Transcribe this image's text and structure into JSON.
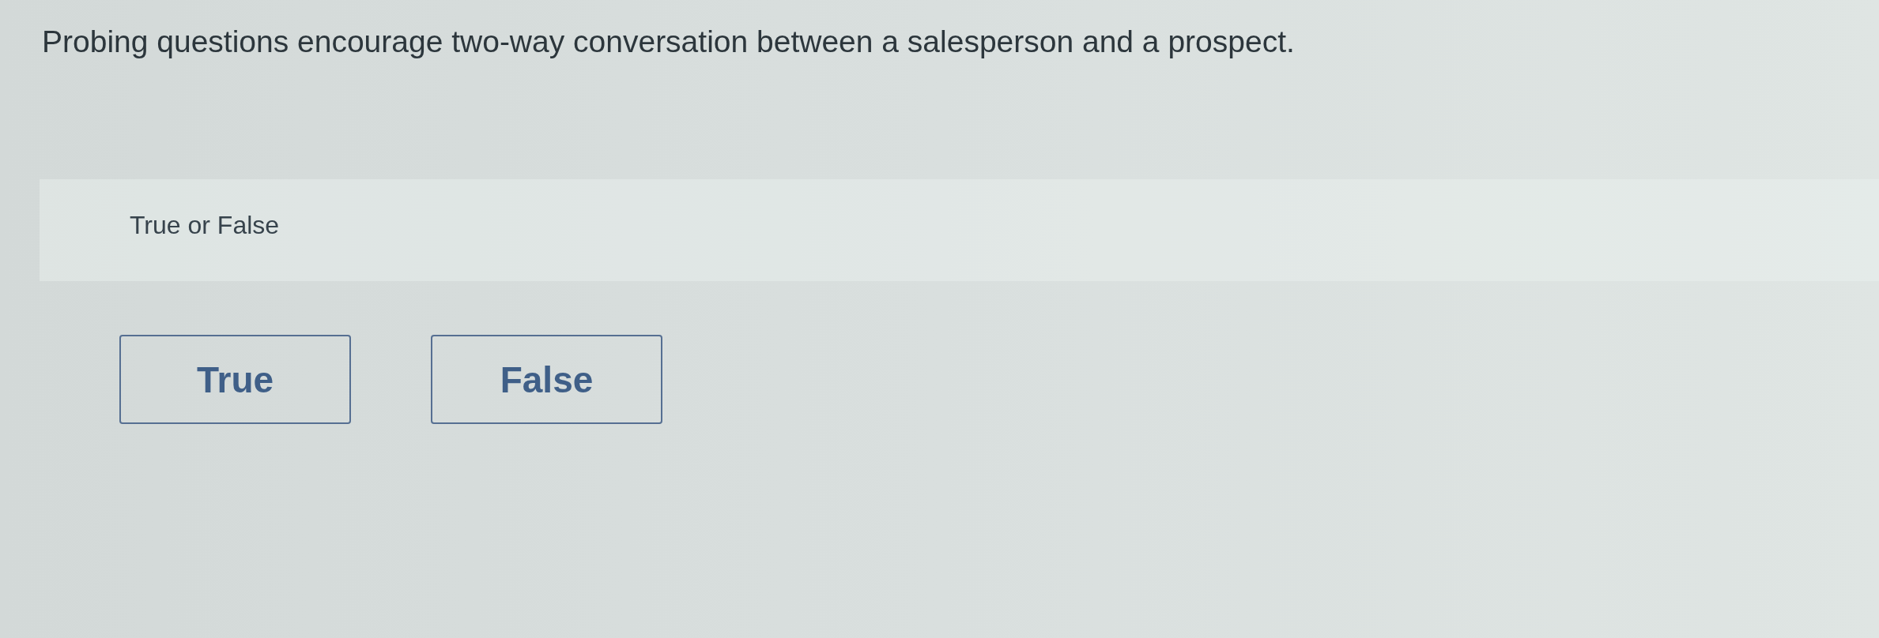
{
  "question": {
    "text": "Probing questions encourage two-way conversation between a salesperson and a prospect."
  },
  "prompt": "True or False",
  "choices": [
    {
      "label": "True",
      "selected": false
    },
    {
      "label": "False",
      "selected": false
    }
  ]
}
